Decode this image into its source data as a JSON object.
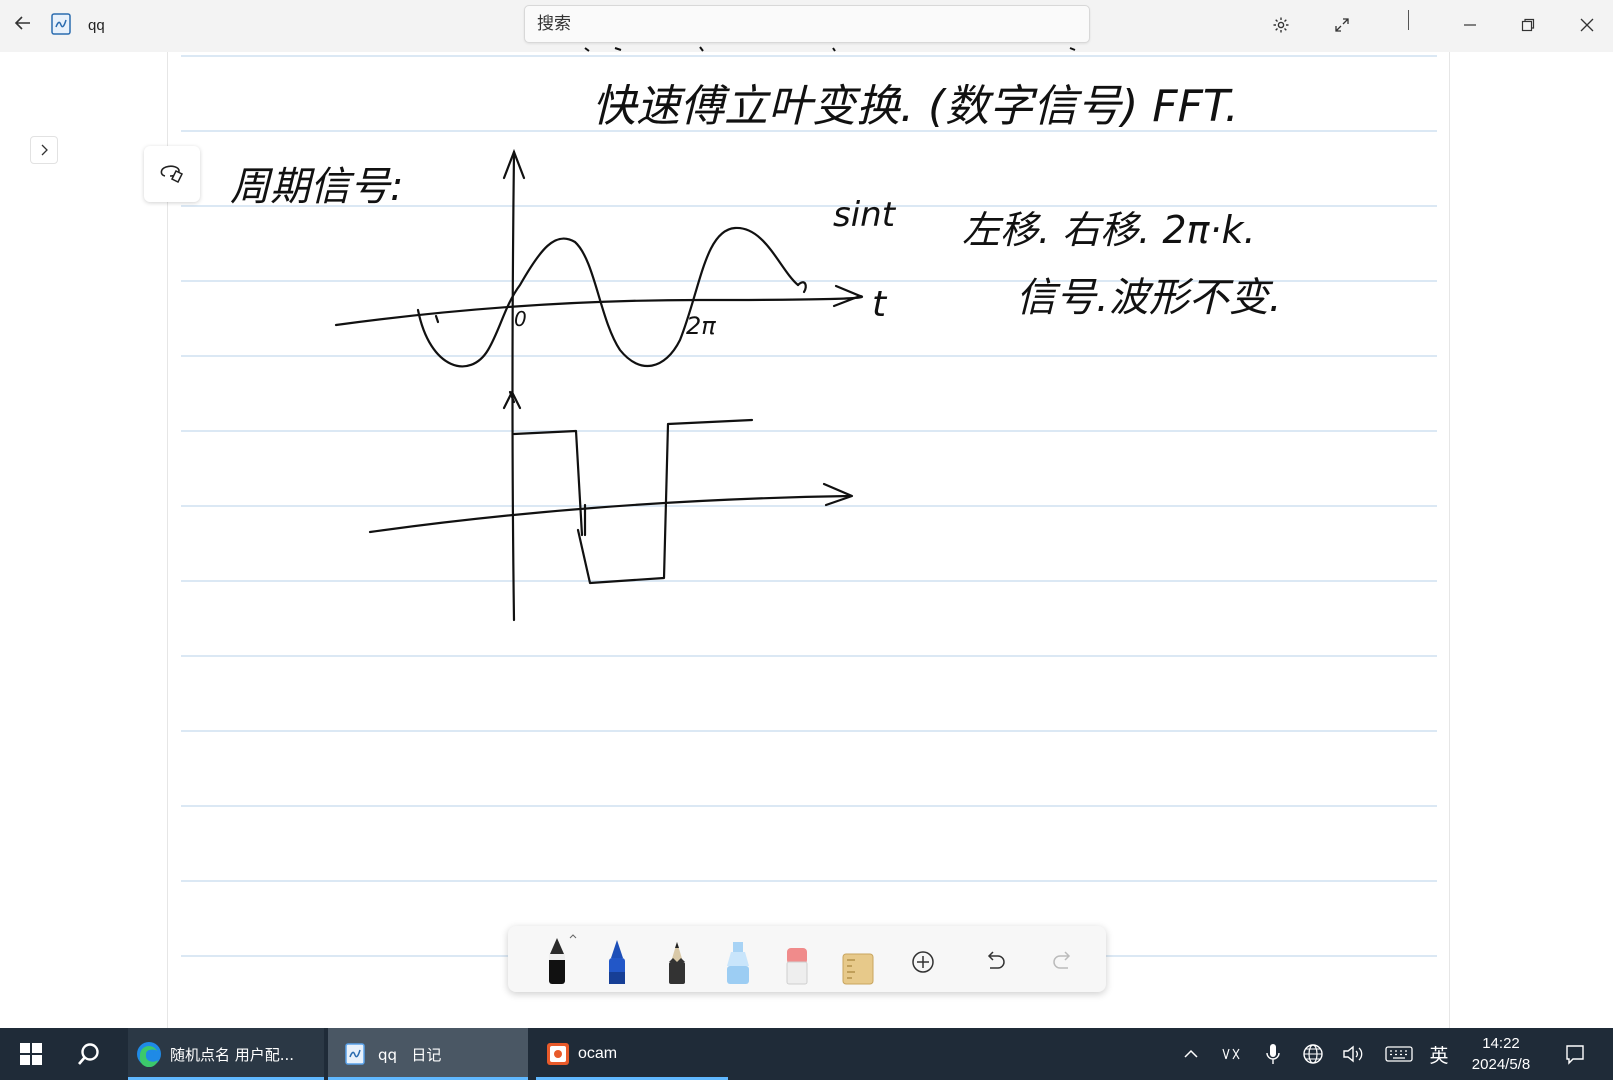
{
  "titlebar": {
    "back_icon": "back-arrow-icon",
    "app_icon": "journal-app-icon",
    "title": "qq",
    "search_placeholder": "搜索",
    "settings_icon": "gear-icon",
    "fullscreen_icon": "expand-icon",
    "window_buttons": [
      "minimize-icon",
      "restore-icon",
      "close-icon"
    ]
  },
  "sidebar": {
    "expand_icon": "chevron-right-icon"
  },
  "canvas": {
    "lasso_icon": "lasso-select-icon",
    "handwriting": {
      "heading": "快速傅立叶变换. (数字信号)  FFT.",
      "periodic_label": "周期信号:",
      "sin_label": "sint",
      "shift_note": "左移. 右移. 2π·k.",
      "waveform_note": "信号.波形不变.",
      "origin_label": "0",
      "period_label": "2π",
      "t_axis_label": "t"
    }
  },
  "pen_toolbar": {
    "tools": [
      "black-pen-icon",
      "blue-pen-icon",
      "pencil-icon",
      "highlighter-icon",
      "eraser-icon",
      "ruler-icon"
    ],
    "actions": [
      "add-space-icon",
      "undo-icon",
      "redo-icon"
    ]
  },
  "taskbar": {
    "start_icon": "windows-start-icon",
    "search_icon": "search-icon",
    "tasks": [
      {
        "icon": "edge-browser-icon",
        "label": "随机点名  用户配..."
      },
      {
        "icon": "journal-app-icon",
        "label": "qq   日记"
      },
      {
        "icon": "ocam-icon",
        "label": "ocam"
      }
    ],
    "tray": {
      "chevron_icon": "chevron-up-icon",
      "ime_icon": "ime-mode-icon",
      "mic_icon": "microphone-icon",
      "network_icon": "globe-icon",
      "volume_icon": "speaker-icon",
      "keyboard_icon": "keyboard-icon",
      "language": "英",
      "notification_icon": "notification-icon"
    },
    "time": "14:22",
    "date": "2024/5/8"
  }
}
